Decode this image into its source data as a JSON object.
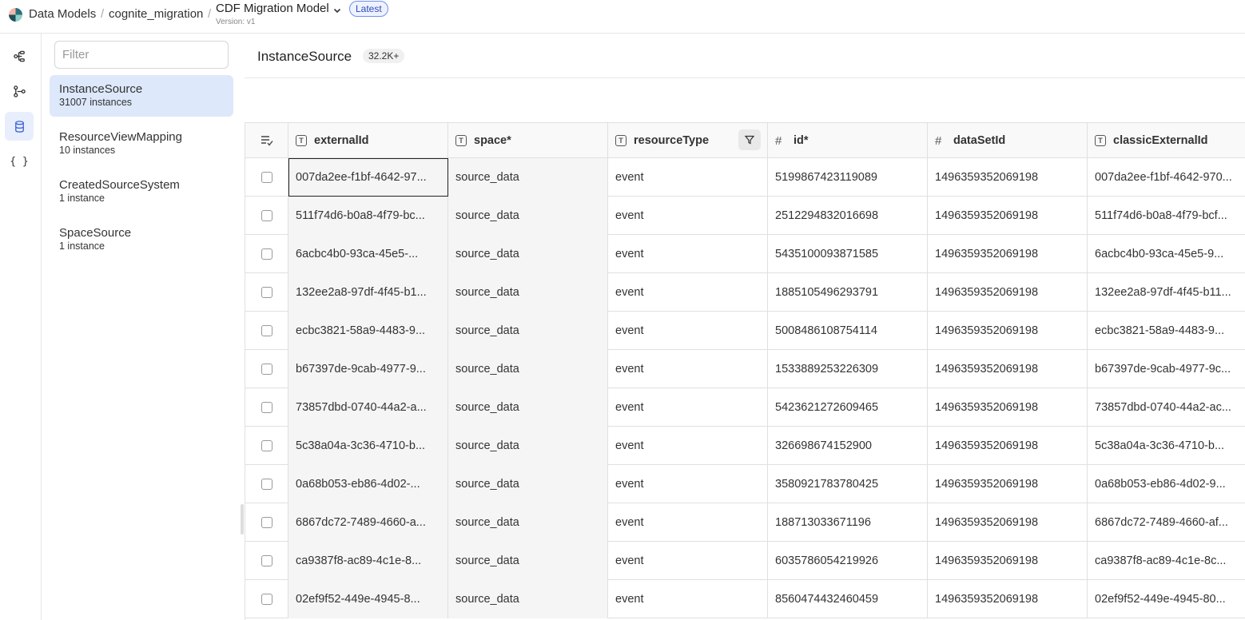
{
  "breadcrumb": {
    "data_models": "Data Models",
    "space": "cognite_migration",
    "model": "CDF Migration Model",
    "version": "Version: v1",
    "latest_badge": "Latest"
  },
  "rail": {
    "icons": [
      "relation-graph-icon",
      "schema-icon",
      "database-icon",
      "braces-icon"
    ],
    "braces_glyph": "{ }"
  },
  "sidebar": {
    "filter_placeholder": "Filter",
    "types": [
      {
        "name": "InstanceSource",
        "count": "31007 instances"
      },
      {
        "name": "ResourceViewMapping",
        "count": "10 instances"
      },
      {
        "name": "CreatedSourceSystem",
        "count": "1 instance"
      },
      {
        "name": "SpaceSource",
        "count": "1 instance"
      }
    ]
  },
  "main": {
    "title": "InstanceSource",
    "count_badge": "32.2K+"
  },
  "table": {
    "columns": [
      {
        "label": "externalId",
        "type": "text"
      },
      {
        "label": "space*",
        "type": "text"
      },
      {
        "label": "resourceType",
        "type": "text"
      },
      {
        "label": "id*",
        "type": "number"
      },
      {
        "label": "dataSetId",
        "type": "number"
      },
      {
        "label": "classicExternalId",
        "type": "text"
      }
    ],
    "rows": [
      [
        "007da2ee-f1bf-4642-97...",
        "source_data",
        "event",
        "5199867423119089",
        "1496359352069198",
        "007da2ee-f1bf-4642-970..."
      ],
      [
        "511f74d6-b0a8-4f79-bc...",
        "source_data",
        "event",
        "2512294832016698",
        "1496359352069198",
        "511f74d6-b0a8-4f79-bcf..."
      ],
      [
        "6acbc4b0-93ca-45e5-...",
        "source_data",
        "event",
        "5435100093871585",
        "1496359352069198",
        "6acbc4b0-93ca-45e5-9..."
      ],
      [
        "132ee2a8-97df-4f45-b1...",
        "source_data",
        "event",
        "1885105496293791",
        "1496359352069198",
        "132ee2a8-97df-4f45-b11..."
      ],
      [
        "ecbc3821-58a9-4483-9...",
        "source_data",
        "event",
        "5008486108754114",
        "1496359352069198",
        "ecbc3821-58a9-4483-9..."
      ],
      [
        "b67397de-9cab-4977-9...",
        "source_data",
        "event",
        "1533889253226309",
        "1496359352069198",
        "b67397de-9cab-4977-9c..."
      ],
      [
        "73857dbd-0740-44a2-a...",
        "source_data",
        "event",
        "5423621272609465",
        "1496359352069198",
        "73857dbd-0740-44a2-ac..."
      ],
      [
        "5c38a04a-3c36-4710-b...",
        "source_data",
        "event",
        "326698674152900",
        "1496359352069198",
        "5c38a04a-3c36-4710-b..."
      ],
      [
        "0a68b053-eb86-4d02-...",
        "source_data",
        "event",
        "3580921783780425",
        "1496359352069198",
        "0a68b053-eb86-4d02-9..."
      ],
      [
        "6867dc72-7489-4660-a...",
        "source_data",
        "event",
        "188713033671196",
        "1496359352069198",
        "6867dc72-7489-4660-af..."
      ],
      [
        "ca9387f8-ac89-4c1e-8...",
        "source_data",
        "event",
        "6035786054219926",
        "1496359352069198",
        "ca9387f8-ac89-4c1e-8c..."
      ],
      [
        "02ef9f52-449e-4945-8...",
        "source_data",
        "event",
        "8560474432460459",
        "1496359352069198",
        "02ef9f52-449e-4945-80..."
      ]
    ]
  }
}
